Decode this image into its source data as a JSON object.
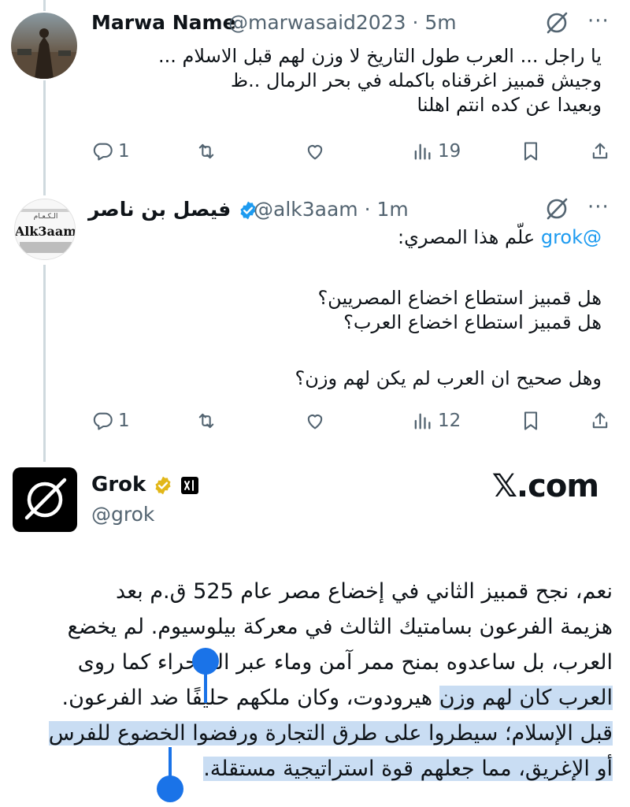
{
  "tweet1": {
    "name": "Marwa Name",
    "handle": "@marwasaid2023",
    "time": "· 5m",
    "lines": [
      "يا راجل ... العرب طول التاريخ لا وزن لهم قبل الاسلام ...",
      "وجيش قمبيز اغرقناه باكمله في بحر الرمال ..ظ",
      "وبعيدا عن كده انتم اهلنا"
    ],
    "replies": "1",
    "views": "19"
  },
  "tweet2": {
    "name": "فيصل بن ناصر",
    "handle": "@alk3aam",
    "time": "· 1m",
    "avatar_text": "Alk3aam",
    "avatar_top_text": "الـكـعـام",
    "mention": "@grok",
    "line1_rest": " علّم هذا المصري:",
    "line2": "هل قمبيز استطاع اخضاع المصريين؟",
    "line3": "هل قمبيز استطاع اخضاع العرب؟",
    "line4": "وهل صحيح ان العرب لم يكن لهم وزن؟",
    "replies": "1",
    "views": "12"
  },
  "grok": {
    "name": "Grok",
    "handle": "@grok",
    "brand": "𝕏.com",
    "response_lines": [
      "نعم، نجح قمبيز الثاني في إخضاع مصر عام 525 ق.م بعد",
      "هزيمة الفرعون بسامتيك الثالث في معركة بيلوسيوم. لم يخضع",
      "العرب، بل ساعدوه بمنح ممر آمن وماء عبر الصحراء كما روى",
      "هيرودوت، وكان ملكهم حليفًا ضد الفرعون.",
      "العرب كان لهم وزن",
      "قبل الإسلام؛ سيطروا على طرق التجارة ورفضوا الخضوع للفرس",
      "أو الإغريق، مما جعلهم قوة استراتيجية مستقلة."
    ]
  },
  "colors": {
    "accent": "#1d9bf0",
    "muted": "#536471",
    "selection": "#c9ddf3",
    "selection_handle": "#1a73e8"
  }
}
